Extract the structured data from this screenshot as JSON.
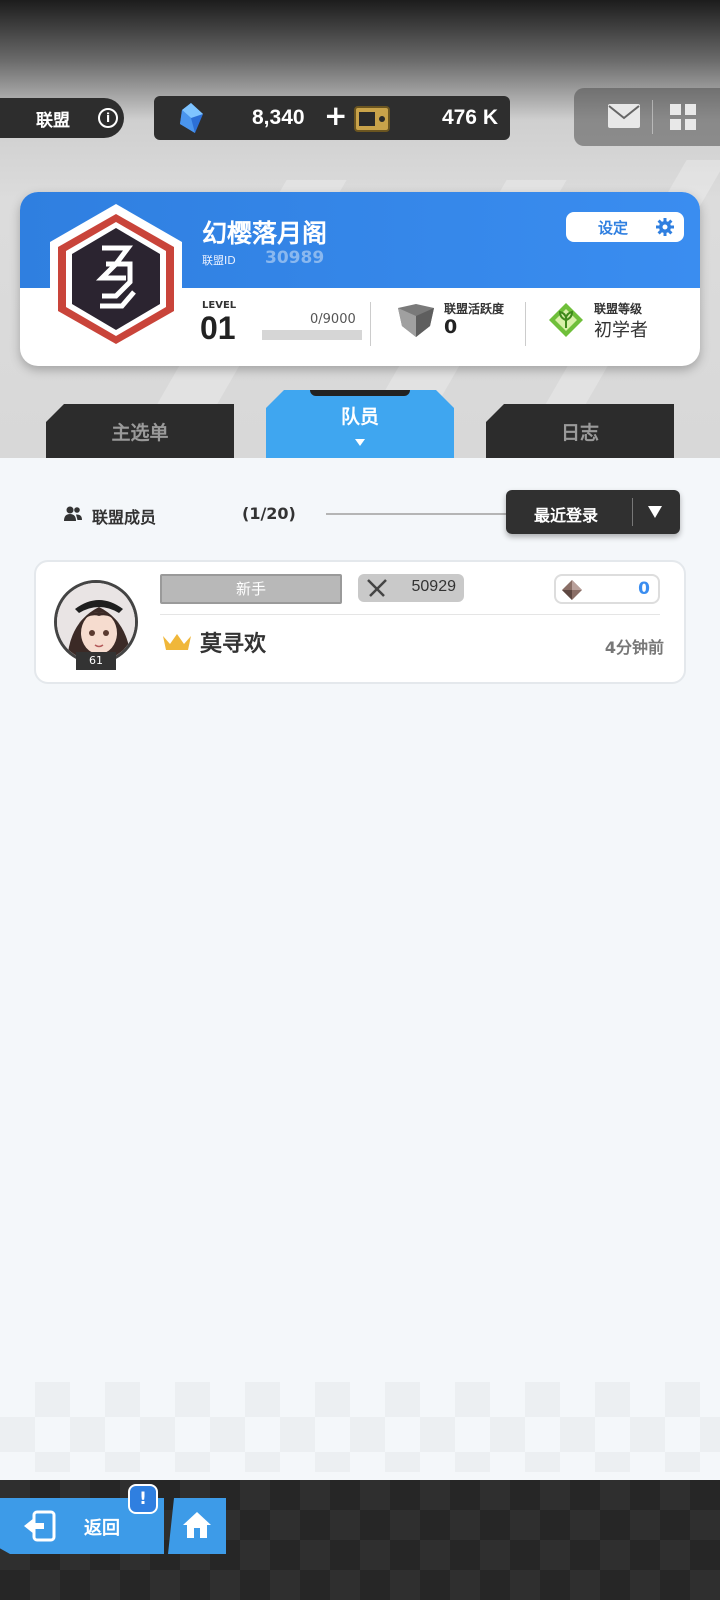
{
  "top_bar": {
    "alliance_label": "联盟",
    "info_icon": "info-icon",
    "gems": "8,340",
    "plus": "+",
    "coins": "476 K",
    "mail_icon": "mail-icon",
    "menu_icon": "grid-menu-icon"
  },
  "alliance": {
    "name": "幻樱落月阁",
    "id_label": "联盟ID",
    "id_value": "30989",
    "settings_label": "设定",
    "level_label": "LEVEL",
    "level_value": "01",
    "exp_text": "0/9000",
    "exp_progress": 0,
    "activity_label": "联盟活跃度",
    "activity_value": "0",
    "rank_label": "联盟等级",
    "rank_value": "初学者"
  },
  "tabs": [
    {
      "label": "主选单",
      "active": false
    },
    {
      "label": "队员",
      "active": true
    },
    {
      "label": "日志",
      "active": false
    }
  ],
  "members_header": {
    "label": "联盟成员",
    "count": "(1/20)",
    "sort_label": "最近登录"
  },
  "members": [
    {
      "level": "61",
      "title": "新手",
      "power": "50929",
      "contribution": "0",
      "name": "莫寻欢",
      "last_login": "4分钟前"
    }
  ],
  "bottom": {
    "back_label": "返回",
    "alert": "!"
  },
  "colors": {
    "accent_blue": "#3a8df0",
    "tab_active": "#3fa6f0",
    "dark": "#2c2c2c"
  }
}
